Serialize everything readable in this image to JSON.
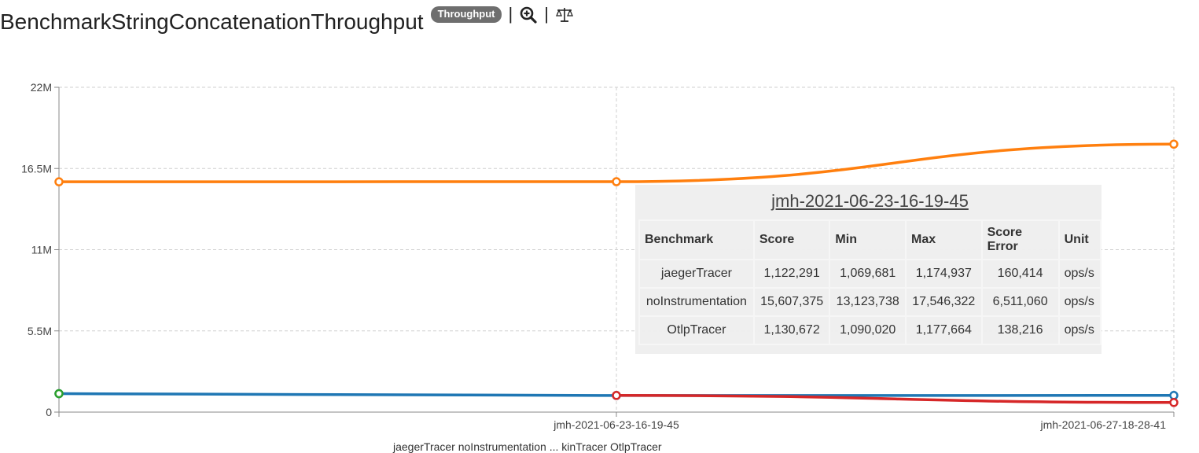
{
  "header": {
    "title": "BenchmarkStringConcatenationThroughput",
    "badge": "Throughput",
    "separator": "|"
  },
  "icons": {
    "zoom": "zoom-in-icon",
    "compare": "balance-scale-icon"
  },
  "chart_data": {
    "type": "line",
    "x": [
      "",
      "jmh-2021-06-23-16-19-45",
      "jmh-2021-06-27-18-28-41"
    ],
    "ylim": [
      0,
      22000000
    ],
    "yticks": [
      0,
      5500000,
      11000000,
      16500000,
      22000000
    ],
    "ytick_labels": [
      "0",
      "5.5M",
      "11M",
      "16.5M",
      "22M"
    ],
    "grid": true,
    "series": [
      {
        "name": "jaegerTracer",
        "color": "#1f77b4",
        "values": [
          1250000,
          1122291,
          1130000
        ]
      },
      {
        "name": "noInstrumentation",
        "color": "#ff7f0e",
        "values": [
          15600000,
          15607375,
          18150000
        ]
      },
      {
        "name": "OtlpTracer",
        "color": "#d62728",
        "values": [
          null,
          1130672,
          650000
        ]
      },
      {
        "name": "",
        "color": "#2ca02c",
        "values": [
          1250000,
          null,
          null
        ]
      }
    ]
  },
  "tooltip": {
    "title": "jmh-2021-06-23-16-19-45",
    "headers": [
      "Benchmark",
      "Score",
      "Min",
      "Max",
      "Score Error",
      "Unit"
    ],
    "rows": [
      [
        "jaegerTracer",
        "1,122,291",
        "1,069,681",
        "1,174,937",
        "160,414",
        "ops/s"
      ],
      [
        "noInstrumentation",
        "15,607,375",
        "13,123,738",
        "17,546,322",
        "6,511,060",
        "ops/s"
      ],
      [
        "OtlpTracer",
        "1,130,672",
        "1,090,020",
        "1,177,664",
        "138,216",
        "ops/s"
      ]
    ]
  },
  "legend": {
    "text": "jaegerTracer    noInstrumentation    ...    kinTracer    OtlpTracer"
  }
}
